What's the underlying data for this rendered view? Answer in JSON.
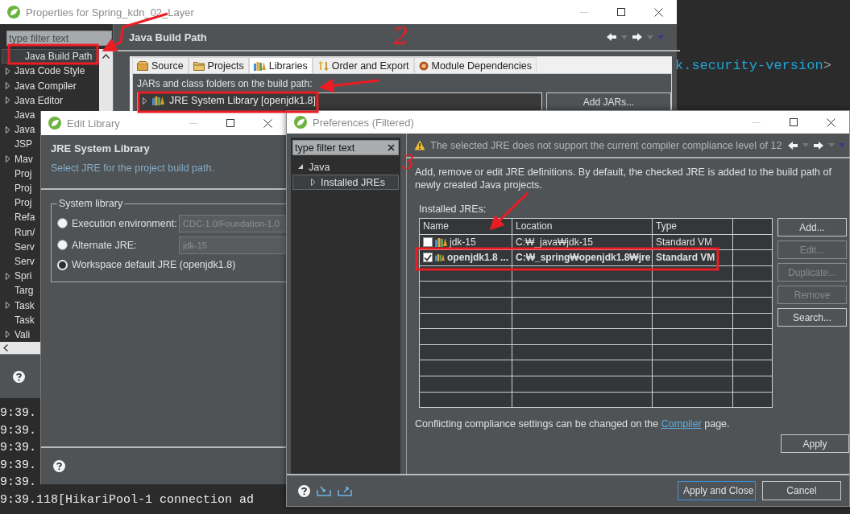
{
  "editor": {
    "code_text": "k.security-version",
    "code_bracket": ">"
  },
  "console": {
    "lines": [
      "9:39.",
      "9:39.",
      "9:39.",
      "9:39.",
      "9:39.",
      "9:39.118[HikariPool-1 connection ad"
    ]
  },
  "properties_window": {
    "title": "Properties for Spring_kdn_02_Layer",
    "filter": {
      "placeholder": "type filter text"
    },
    "nav_items": [
      {
        "label": "Java Build Path",
        "expandable": false,
        "selected": true
      },
      {
        "label": "Java Code Style",
        "expandable": true,
        "selected": false
      },
      {
        "label": "Java Compiler",
        "expandable": true,
        "selected": false
      },
      {
        "label": "Java Editor",
        "expandable": true,
        "selected": false
      },
      {
        "label": "Java",
        "expandable": false,
        "selected": false
      },
      {
        "label": "Java",
        "expandable": true,
        "selected": false
      },
      {
        "label": "JSP",
        "expandable": false,
        "selected": false
      },
      {
        "label": "Mav",
        "expandable": true,
        "selected": false
      },
      {
        "label": "Proj",
        "expandable": false,
        "selected": false
      },
      {
        "label": "Proj",
        "expandable": false,
        "selected": false
      },
      {
        "label": "Proj",
        "expandable": false,
        "selected": false
      },
      {
        "label": "Refa",
        "expandable": false,
        "selected": false
      },
      {
        "label": "Run/",
        "expandable": false,
        "selected": false
      },
      {
        "label": "Serv",
        "expandable": false,
        "selected": false
      },
      {
        "label": "Serv",
        "expandable": false,
        "selected": false
      },
      {
        "label": "Spri",
        "expandable": true,
        "selected": false
      },
      {
        "label": "Targ",
        "expandable": false,
        "selected": false
      },
      {
        "label": "Task",
        "expandable": true,
        "selected": false
      },
      {
        "label": "Task",
        "expandable": false,
        "selected": false
      },
      {
        "label": "Vali",
        "expandable": true,
        "selected": false
      }
    ],
    "page_title": "Java Build Path",
    "tabs": [
      {
        "label": "Source",
        "kind": "source",
        "selected": false
      },
      {
        "label": "Projects",
        "kind": "projects",
        "selected": false
      },
      {
        "label": "Libraries",
        "kind": "libraries",
        "selected": true
      },
      {
        "label": "Order and Export",
        "kind": "order",
        "selected": false
      },
      {
        "label": "Module Dependencies",
        "kind": "module",
        "selected": false
      }
    ],
    "section_label": "JARs and class folders on the build path:",
    "build_path_entries": [
      {
        "label": "JRE System Library [openjdk1.8]",
        "expanded": false
      }
    ],
    "buttons": [
      "Add JARs..."
    ]
  },
  "edit_library_dialog": {
    "title": "Edit Library",
    "heading": "JRE System Library",
    "description": "Select JRE for the project build path.",
    "group_label": "System library",
    "options": [
      {
        "label": "Execution environment:",
        "selected": false,
        "field_value": "CDC-1.0/Foundation-1.0"
      },
      {
        "label": "Alternate JRE:",
        "selected": false,
        "field_value": "jdk-15"
      },
      {
        "label": "Workspace default JRE (openjdk1.8)",
        "selected": true
      }
    ]
  },
  "preferences_dialog": {
    "title": "Preferences (Filtered)",
    "filter": {
      "placeholder": "type filter text"
    },
    "tree": [
      {
        "label": "Java",
        "expanded": true,
        "selected": false,
        "children": [
          {
            "label": "Installed JREs",
            "expanded": false,
            "selected": true
          }
        ]
      }
    ],
    "warning": "The selected JRE does not support the current compiler compliance level of 12",
    "description": "Add, remove or edit JRE definitions. By default, the checked JRE is added to the build path of newly created Java projects.",
    "table_label": "Installed JREs:",
    "table": {
      "columns": [
        "Name",
        "Location",
        "Type"
      ],
      "rows": [
        {
          "checked": false,
          "cells": [
            "jdk-15",
            "C:₩_java₩jdk-15",
            "Standard VM"
          ]
        },
        {
          "checked": true,
          "cells": [
            "openjdk1.8 ...",
            "C:₩_spring₩openjdk1.8₩jre",
            "Standard VM"
          ]
        }
      ]
    },
    "side_buttons": [
      {
        "label": "Add...",
        "disabled": false
      },
      {
        "label": "Edit...",
        "disabled": true
      },
      {
        "label": "Duplicate...",
        "disabled": true
      },
      {
        "label": "Remove",
        "disabled": true
      },
      {
        "label": "Search...",
        "disabled": false
      }
    ],
    "note": {
      "before": "Conflicting compliance settings can be changed on the ",
      "link": "Compiler",
      "after": " page."
    },
    "apply_button": "Apply",
    "buttons": [
      {
        "label": "Apply and Close",
        "default": true
      },
      {
        "label": "Cancel",
        "default": false
      }
    ]
  },
  "annotation_marks": [
    "2",
    "3"
  ]
}
